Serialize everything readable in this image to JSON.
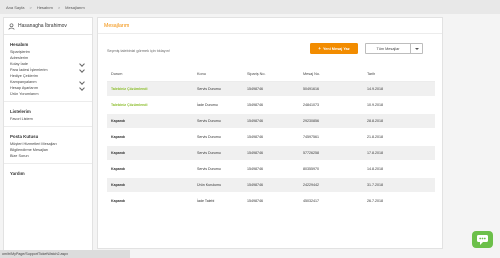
{
  "breadcrumb": {
    "items": [
      "Ana Sayfa",
      "Hesabım",
      "Mesajlarım"
    ]
  },
  "sidebar": {
    "user_name": "Hasanagha İbrahimov",
    "sections": [
      {
        "title": "Hesabım",
        "items": [
          {
            "label": "Siparişlerim",
            "expandable": false
          },
          {
            "label": "Adreslerim",
            "expandable": false
          },
          {
            "label": "Kolay İade",
            "expandable": true
          },
          {
            "label": "Para İadesi İşlemlerim",
            "expandable": true
          },
          {
            "label": "Hediye Çeklerim",
            "expandable": false
          },
          {
            "label": "Kampanyalarım",
            "expandable": true
          },
          {
            "label": "Hesap Ayarlarım",
            "expandable": true
          },
          {
            "label": "Ürün Yorumlarım",
            "expandable": false
          }
        ]
      },
      {
        "title": "Listelerim",
        "items": [
          {
            "label": "Favori Listem",
            "expandable": false
          }
        ]
      },
      {
        "title": "Posta Kutusu",
        "items": [
          {
            "label": "Müşteri Hizmetleri Mesajları",
            "expandable": false
          },
          {
            "label": "Bilgilendirme Mesajları",
            "expandable": false
          },
          {
            "label": "Bize Sorun",
            "expandable": false
          }
        ]
      },
      {
        "title": "Yardım",
        "items": []
      }
    ]
  },
  "main": {
    "title": "Mesajlarım",
    "info_text": "Seçmiş talebinizi görmek için tıklayın!",
    "new_message_label": "Yeni Mesaj Yaz",
    "filter_value": "Tüm Mesajlar",
    "columns": [
      "Durum",
      "Konu",
      "Sipariş No.",
      "Mesaj No.",
      "Tarih"
    ],
    "rows": [
      {
        "status": "Talebiniz Çözümlendi",
        "status_type": "open",
        "subject": "Servis Durumu",
        "order_no": "15498746",
        "message_no": "50491616",
        "date": "14.9.2018"
      },
      {
        "status": "Talebiniz Çözümlendi",
        "status_type": "open",
        "subject": "İade Durumu",
        "order_no": "15498746",
        "message_no": "24841073",
        "date": "10.9.2018"
      },
      {
        "status": "Kapandı",
        "status_type": "closed",
        "subject": "Servis Durumu",
        "order_no": "15498746",
        "message_no": "29230856",
        "date": "28.8.2018"
      },
      {
        "status": "Kapandı",
        "status_type": "closed",
        "subject": "Servis Durumu",
        "order_no": "15498746",
        "message_no": "74597561",
        "date": "21.8.2018"
      },
      {
        "status": "Kapandı",
        "status_type": "closed",
        "subject": "Servis Durumu",
        "order_no": "15498746",
        "message_no": "57726258",
        "date": "17.8.2018"
      },
      {
        "status": "Kapandı",
        "status_type": "closed",
        "subject": "Servis Durumu",
        "order_no": "15498746",
        "message_no": "80355970",
        "date": "14.8.2018"
      },
      {
        "status": "Kapandı",
        "status_type": "closed",
        "subject": "Ürün Kurulumu",
        "order_no": "15498746",
        "message_no": "24229442",
        "date": "31.7.2018"
      },
      {
        "status": "Kapandı",
        "status_type": "closed",
        "subject": "İade Talebi",
        "order_no": "15498746",
        "message_no": "45032417",
        "date": "26.7.2018"
      }
    ]
  },
  "status_bar": {
    "url": "om/tr/MyPage/SupportTicketWatch2.aspx"
  },
  "colors": {
    "accent": "#f28c00",
    "resolved": "#8bbd2b",
    "chat": "#6cc04a"
  },
  "icons": {
    "user": "user-icon",
    "chevron": "chevron-down-icon",
    "plus": "plus-icon",
    "chat": "chat-icon"
  }
}
